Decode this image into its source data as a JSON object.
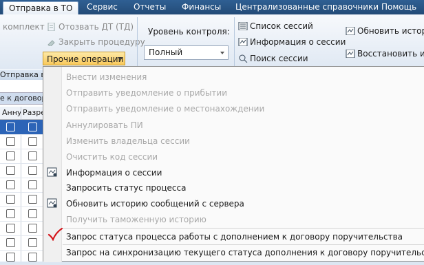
{
  "tabs": [
    {
      "label": "Отправка в ТО",
      "active": true
    },
    {
      "label": "Сервис"
    },
    {
      "label": "Отчеты"
    },
    {
      "label": "Финансы"
    },
    {
      "label": "Централизованные справочники"
    },
    {
      "label": "Помощь"
    }
  ],
  "ribbon": {
    "komplekt": "комплект",
    "otozvat": "Отозвать ДТ (ТД)",
    "zakryt": "Закрыть процедуру",
    "prochie": "Прочие операции",
    "level_label": "Уровень контроля:",
    "level_value": "Полный",
    "sessions_list": "Список сессий",
    "session_info": "Информация о сессии",
    "session_search": "Поиск сессии",
    "update_history": "Обновить историю",
    "restore": "Восстановить ист"
  },
  "left_panel": {
    "header": "Отправка в",
    "subheader": "е к договору",
    "col1": "Анну",
    "col2": "Разре"
  },
  "menu": {
    "items": [
      {
        "label": "Внести изменения",
        "enabled": false
      },
      {
        "label": "Отправить уведомление о прибытии",
        "enabled": false
      },
      {
        "label": "Отправить уведомление о местонахождении",
        "enabled": false
      },
      {
        "label": "Аннулировать ПИ",
        "enabled": false
      },
      {
        "label": "Изменить владельца сессии",
        "enabled": false
      },
      {
        "label": "Очистить код сессии",
        "enabled": false
      },
      {
        "label": "Информация о сессии",
        "enabled": true,
        "icon": "session-info-icon"
      },
      {
        "label": "Запросить статус процесса",
        "enabled": true
      },
      {
        "label": "Обновить историю сообщений с сервера",
        "enabled": true,
        "icon": "refresh-history-icon"
      },
      {
        "label": "Получить таможенную  историю",
        "enabled": false
      },
      {
        "label": "Запрос статуса процесса работы с дополнением к договору поручительства",
        "enabled": true,
        "icon": "checkmark-icon"
      },
      {
        "label": "Запрос на синхронизацию текущего статуса дополнения к договору поручительства",
        "enabled": true
      }
    ]
  },
  "colors": {
    "accent": "#2f5f93",
    "highlight": "#f9c95b",
    "check": "#d4141a"
  }
}
